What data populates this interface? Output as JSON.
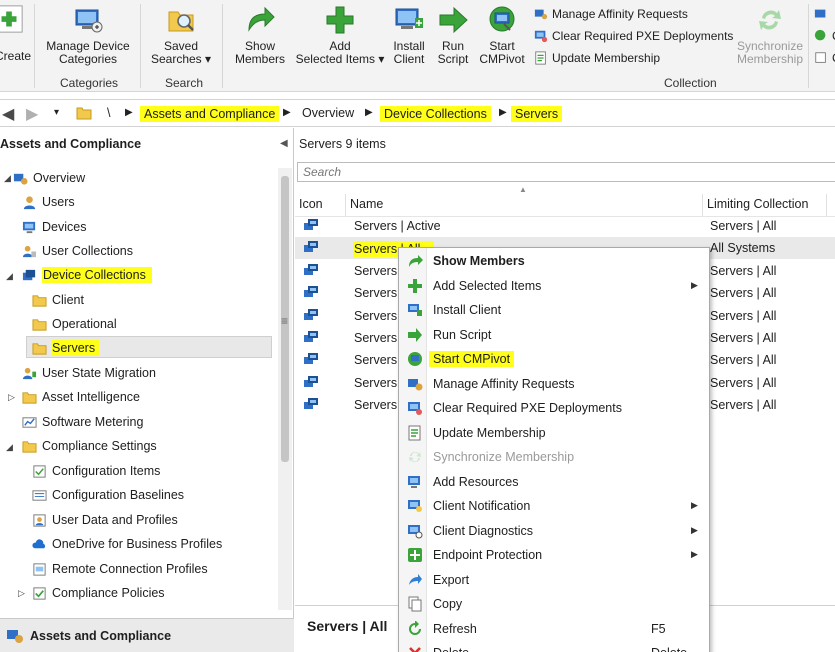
{
  "ribbon": {
    "create_label": "Create",
    "groups": [
      {
        "label": "Categories",
        "buttons": [
          {
            "line1": "Manage Device",
            "line2": "Categories"
          }
        ]
      },
      {
        "label": "Search",
        "buttons": [
          {
            "line1": "Saved",
            "line2": "Searches ▾"
          }
        ]
      },
      {
        "label": "Collection",
        "buttons": [
          {
            "line1": "Show",
            "line2": "Members"
          },
          {
            "line1": "Add",
            "line2": "Selected Items ▾"
          },
          {
            "line1": "Install",
            "line2": "Client"
          },
          {
            "line1": "Run",
            "line2": "Script"
          },
          {
            "line1": "Start",
            "line2": "CMPivot"
          }
        ]
      }
    ],
    "small_buttons": [
      "Manage Affinity Requests",
      "Clear Required PXE Deployments",
      "Update Membership"
    ],
    "sync_line1": "Synchronize",
    "sync_line2": "Membership",
    "right_cut_letters": [
      "C",
      "C"
    ],
    "colors": {
      "green": "#3aa33a",
      "blue": "#2f6fc6",
      "highlight": "#ffff1a"
    }
  },
  "address_bar": {
    "root": "\\",
    "crumbs": [
      "Assets and Compliance",
      "Overview",
      "Device Collections",
      "Servers"
    ]
  },
  "nav": {
    "header": "Assets and Compliance",
    "items": [
      {
        "label": "Overview",
        "icon": "overview-icon"
      },
      {
        "label": "Users",
        "icon": "user-icon"
      },
      {
        "label": "Devices",
        "icon": "devices-icon"
      },
      {
        "label": "User Collections",
        "icon": "user-collections-icon"
      },
      {
        "label": "Device Collections",
        "icon": "device-collections-icon"
      },
      {
        "label": "Client",
        "icon": "folder-icon"
      },
      {
        "label": "Operational",
        "icon": "folder-icon"
      },
      {
        "label": "Servers",
        "icon": "folder-icon"
      },
      {
        "label": "User State Migration",
        "icon": "user-state-icon"
      },
      {
        "label": "Asset Intelligence",
        "icon": "folder-icon"
      },
      {
        "label": "Software Metering",
        "icon": "metering-icon"
      },
      {
        "label": "Compliance Settings",
        "icon": "folder-icon"
      },
      {
        "label": "Configuration Items",
        "icon": "config-item-icon"
      },
      {
        "label": "Configuration Baselines",
        "icon": "baseline-icon"
      },
      {
        "label": "User Data and Profiles",
        "icon": "profile-icon"
      },
      {
        "label": "OneDrive for Business Profiles",
        "icon": "onedrive-icon"
      },
      {
        "label": "Remote Connection Profiles",
        "icon": "remote-icon"
      },
      {
        "label": "Compliance Policies",
        "icon": "policy-icon"
      }
    ],
    "workspace": "Assets and Compliance"
  },
  "list": {
    "title": "Servers 9 items",
    "search_placeholder": "Search",
    "columns": [
      "Icon",
      "Name",
      "Limiting Collection"
    ],
    "rows": [
      {
        "name": "Servers | Active",
        "limit": "Servers | All"
      },
      {
        "name": "Servers | All",
        "limit": "All Systems"
      },
      {
        "name": "Servers |",
        "limit": "Servers | All"
      },
      {
        "name": "Servers |",
        "limit": "Servers | All"
      },
      {
        "name": "Servers |",
        "limit": "Servers | All"
      },
      {
        "name": "Servers |",
        "limit": "Servers | All"
      },
      {
        "name": "Servers |",
        "limit": "Servers | All"
      },
      {
        "name": "Servers |",
        "limit": "Servers | All"
      },
      {
        "name": "Servers |",
        "limit": "Servers | All"
      }
    ],
    "detail_title": "Servers | All"
  },
  "context_menu": {
    "items": [
      {
        "label": "Show Members",
        "bold": true,
        "sub": false,
        "key": "",
        "disabled": false
      },
      {
        "label": "Add Selected Items",
        "bold": false,
        "sub": true,
        "key": "",
        "disabled": false
      },
      {
        "label": "Install Client",
        "bold": false,
        "sub": false,
        "key": "",
        "disabled": false
      },
      {
        "label": "Run Script",
        "bold": false,
        "sub": false,
        "key": "",
        "disabled": false
      },
      {
        "label": "Start CMPivot",
        "bold": false,
        "sub": false,
        "key": "",
        "disabled": false,
        "highlight": true
      },
      {
        "label": "Manage Affinity Requests",
        "bold": false,
        "sub": false,
        "key": "",
        "disabled": false
      },
      {
        "label": "Clear Required PXE Deployments",
        "bold": false,
        "sub": false,
        "key": "",
        "disabled": false
      },
      {
        "label": "Update Membership",
        "bold": false,
        "sub": false,
        "key": "",
        "disabled": false
      },
      {
        "label": "Synchronize Membership",
        "bold": false,
        "sub": false,
        "key": "",
        "disabled": true
      },
      {
        "label": "Add Resources",
        "bold": false,
        "sub": false,
        "key": "",
        "disabled": false
      },
      {
        "label": "Client Notification",
        "bold": false,
        "sub": true,
        "key": "",
        "disabled": false
      },
      {
        "label": "Client Diagnostics",
        "bold": false,
        "sub": true,
        "key": "",
        "disabled": false
      },
      {
        "label": "Endpoint Protection",
        "bold": false,
        "sub": true,
        "key": "",
        "disabled": false
      },
      {
        "label": "Export",
        "bold": false,
        "sub": false,
        "key": "",
        "disabled": false
      },
      {
        "label": "Copy",
        "bold": false,
        "sub": false,
        "key": "",
        "disabled": false
      },
      {
        "label": "Refresh",
        "bold": false,
        "sub": false,
        "key": "F5",
        "disabled": false
      },
      {
        "label": "Delete",
        "bold": false,
        "sub": false,
        "key": "Delete",
        "disabled": false
      }
    ]
  }
}
